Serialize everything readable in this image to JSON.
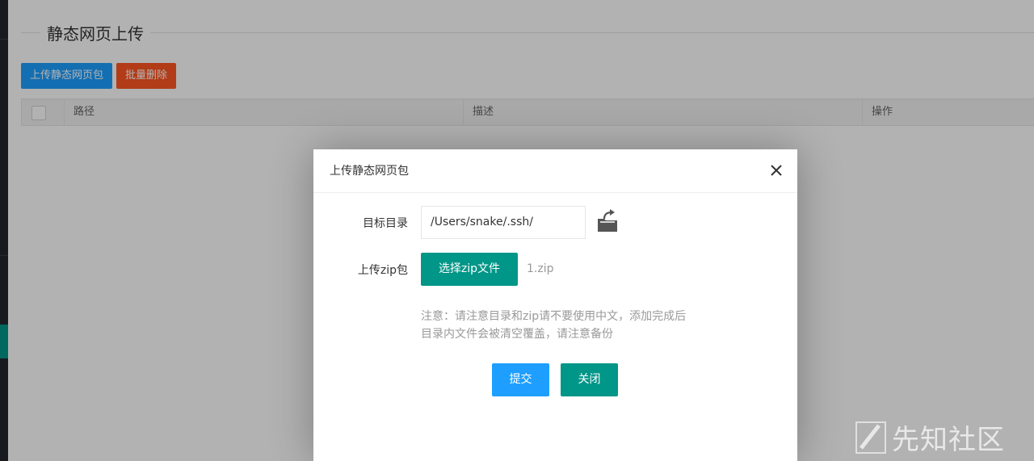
{
  "page": {
    "title": "静态网页上传",
    "toolbar": {
      "upload_label": "上传静态网页包",
      "batch_delete_label": "批量删除"
    },
    "table": {
      "columns": [
        "路径",
        "描述",
        "操作"
      ]
    }
  },
  "dialog": {
    "title": "上传静态网页包",
    "target_dir_label": "目标目录",
    "target_dir_value": "/Users/snake/.ssh/",
    "upload_zip_label": "上传zip包",
    "choose_zip_label": "选择zip文件",
    "selected_file": "1.zip",
    "note": "注意：请注意目录和zip请不要使用中文，添加完成后目录内文件会被清空覆盖，请注意备份",
    "submit_label": "提交",
    "close_label": "关闭"
  },
  "watermark": {
    "text": "先知社区"
  },
  "colors": {
    "primary_blue": "#1e9fff",
    "danger_orange": "#ff5722",
    "teal": "#009688"
  }
}
